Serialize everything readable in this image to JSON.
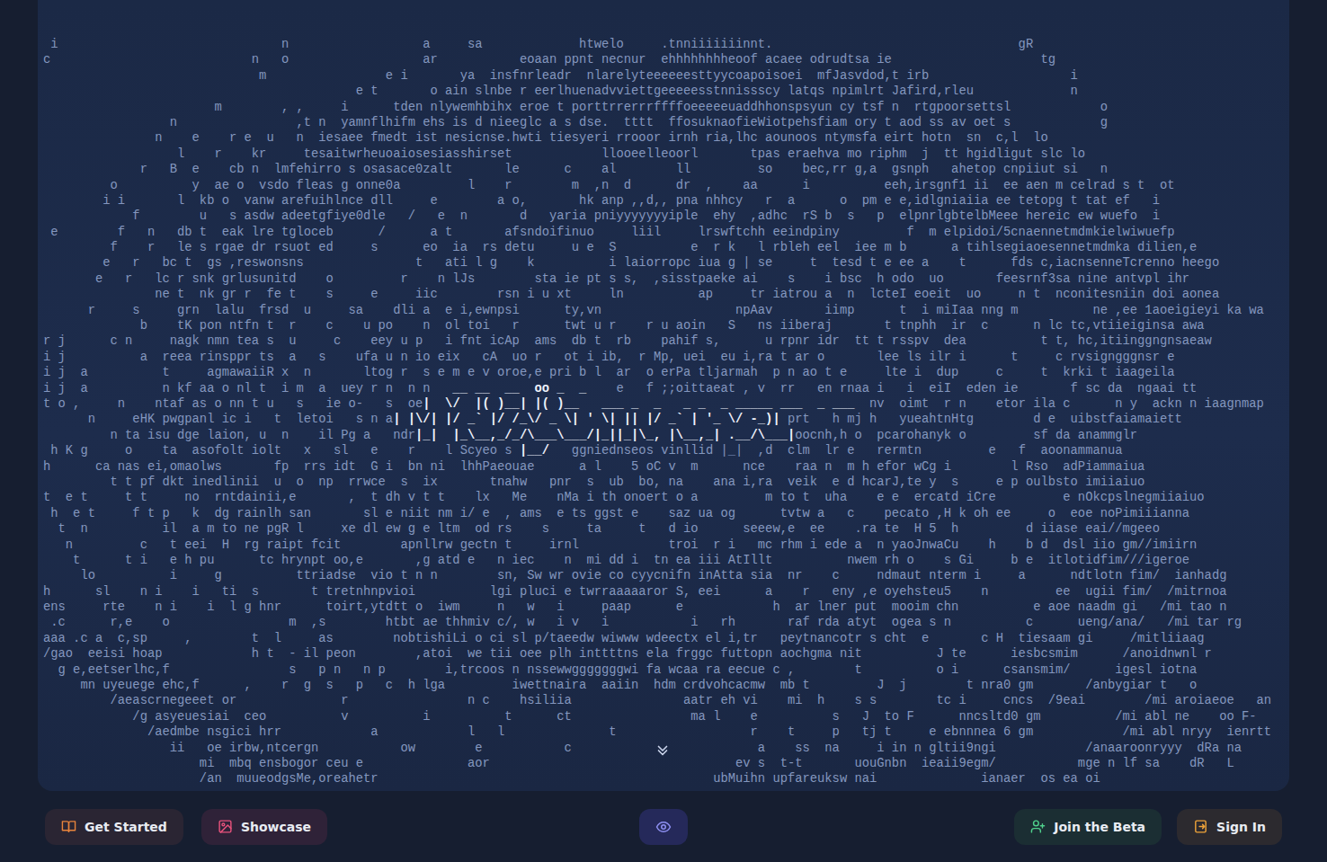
{
  "art": {
    "lines": [
      " i                              n                  a     sa             htwelo     .tnniiiiiiinnt.                                 gR",
      "c                           n   o                  ar           eoaan ppnt necnur  ehhhhhhhheoof acaee odrudtsa ie                    tg",
      "                             m                e i       ya  insfnrleadr  nlarelyteeeeeesttyycoapoisoei  mfJasvdod,t irb                   i",
      "                                          e t       o ain slnbe r eerlhuenadvviettgeeeeesstnnissscy latqs npimlrt Jafird,rleu             n",
      "                       m        , ,     i      tden nlywemhbihx eroe t porttrrerrrffffoeeeeeuaddhhonspsyun cy tsf n  rtgpoorsettsl            o",
      "                 n                ,t n  yamnflhifm ehs is d nieeglc a s dse.  tttt  ffosuknaofieWiotpehsfiam ory t aod ss av oet s            g",
      "               n    e    r e  u   n  iesaee fmedt ist nesicnse.hwti tiesyeri rrooor irnh ria,lhc aounoos ntymsfa eirt hotn  sn  c,l  lo",
      "                  l    r    kr     tesaitwrheuoaiosesiasshirset            llooeelleoorl       tpas eraehva mo riphm  j  tt hgidligut slc lo",
      "             r   B  e    cb n  lmfehirro s osasace0zalt       le      c    al        ll         so    bec,rr g,a  gsnph   ahetop cnpiiut si   n",
      "         o          y  ae o  vsdo fleas g onne0a         l    r        m  ,n  d      dr  ,    aa      i          eeh,irsgnf1 ii  ee aen m celrad s t  ot",
      "        i i       l  kb o  vanw arefuihlnce dll     e        a o,       hk anp ,,d,, pna nhhcy   r  a      o  pm e e,idlgniaiia ee tetopg t tat ef   i",
      "            f        u   s asdw adeetgfiye0dle   /   e  n       d   yaria pniyyyyyyyiple  ehy  ,adhc  rS b  s   p  elpnrlgbtelbMeee hereic ew wuefo  i",
      " e        f   n   db t  eak lre tgloceb      /      a t       afsndoifinuo     liil     lrswftchh eeindpiny         f  m elpidoi/5cnaennetmdmkielwiwuefp",
      "         f    r   le s rgae dr rsuot ed     s      eo  ia  rs detu     u e  S          e  r k   l rbleh eel  iee m b      a tihlsegiaoesennetmdmka dilien,e",
      "        e   r   bc t  gs ,reswonsns               t   ati l g    k          i laiorropc iua g | se     t  tesd t e ee a    t      fds c,iacnsenneTcrenno heego",
      "       e   r   lc r snk grlusunitd    o         r    n lJs        sta ie pt s s,  ,sisstpaeke ai    s    i bsc  h odo  uo       feesrnf3sa nine antvpl ihr",
      "               ne t  nk gr r  fe t    s     e     iic        rsn i u xt     ln          ap     tr iatrou a  n  lcteI eoeit  uo     n t  nconitesniin doi aonea",
      "      r     s     grn  lalu  frsd  u     sa    dli a  e i,ewnpsi      ty,vn                  npAav       iimp      t  i miIaa nng m          ne ,ee 1aoeigieyi ka wa",
      "             b    tK pon ntfn t  r    c    u po    n  ol toi   r      twt u r    r u aoin   S   ns iiberaj       t tnphh  ir  c      n lc tc,vtiieiginsa awa",
      "r j      c n     nagk nmn tea s  u     c    eey u p   i fnt icAp  ams  db t  rb    pahif s,      u rpnr idr  tt t rsspv  dea          t t, hc,itiinggngnsaeaw",
      "i j          a  reea rinsppr ts  a   s    ufa u n io eix   cA  uo r   ot i ib,  r Mp, uei  eu i,ra t ar o       lee ls ilr i      t     c rvsigngggnsr e",
      "i j  a          t     agmawaiiR x  n       ltog r  s e m e v oroe,e pri b l  ar  o erPa tljarmah  p n ao t e     lte i  dup     c     t  krki t iaageila",
      "h      ca nas ei,omaolws       fp  rrs idt  G i  bn ni  lhhPaeouae      a l    5 oC v  m      nce    raa n  m h efor wCg i        l Rso  adPiammaiua",
      "         t t pf dkt inedlinii  u  o  np  rrwce  s  ix       tnahw   pnr  s  ub  bo, na    ana i,ra  veik  e d hcarJ,te y  s     e p oulbsto imiiaiuo",
      "t  e t     t t     no  rntdainii,e       ,  t dh v t t    lx   Me    nMa i th onoert o a         m to t  uha    e e  ercatd iCre         e nOkcpslnegmiiaiuo",
      " h  e t     f t p   k  dg rainlh san       sl e niit nm i/ e  , ams  e ts ggst e    saz ua og      tvtw a   c    pecato ,H k oh ee     o  eoe noPimiiianna",
      "  t  n          il  a m to ne pgR l     xe dl ew g e ltm  od rs    s     ta     t   d io      seeew,e  ee    .ra te  H 5  h         d iiase eai//mgeeo",
      "   n         c   t eei  H  rg raipt fcit        apnllrw gectn t     irnl            troi  r i   mc rhm i ede a  n yaoJnwaCu    h    b d  dsl iio gm//imiirn",
      "    t      t i   e h pu      tc hrynpt oo,e       ,g atd e   n iec    n  mi dd i  tn ea iii AtIllt          nwem rh o    s Gi     b e  itlotidfim///igeroe",
      "     lo          i     g          ttriadse  vio t n n        sn, Sw wr ovie co cyycnifn inAtta sia  nr    c     ndmaut nterm i     a      ndtlotn fim/  ianhadg",
      "h      sl    n i    i   ti  s       t tretnhnpvioi          lgi pluci e twrraaaaaror S, eei      a    r   eny ,e oyehsteu5    n         ee  ugii fim/  /mitrnoa",
      "ens     rte    n i    i  l g hnr      toirt,ytdtt o  iwm     n   w   i     paap      e            h  ar lner put  mooim chn          e aoe naadm gi   /mi tao n",
      " .c      r,e    o                m  ,s        htbt ae thhmiv c/, w   i v   i           i   rh       raf rda atyt  ogea s n          c      ueng/ana/   /mi tar rg",
      "aaa .c a  c,sp     ,        t  l     as        nobtishiLi o ci sl p/taeedw wiwww wdeectx el i,tr   peytnancotr s cht  e       c H  tiesaam gi     /mitliiaag",
      "/gao  eeisi hoap            h t  - il peon        ,atoi  we tii oee plh inttttns ela frggc futtopn aochgma nit          J te      iesbcsmim      /anoidnwnl r",
      "  g e,eetserlhc,f                s   p n   n p        i,trcoos n nssewwgggggggwi fa wcaa ra eecue c ,        t          o i      csansmim/      igesl iotna",
      "     mn uyeuege ehc,f      ,    r  g  s   p   c  h lga         iwettnaira  aaiin  hdm crdvohcacmw  mb t         J  j        t nra0 gm       /anbygiar t   o",
      "         /aeascrnegeeet or              r                n c    hsiliia               aatr eh vi    mi  h    s s        tc i     cncs  /9eai        /mi aroiaeoe   an",
      "            /g asyeuesiai  ceo          v          i          t      ct                ma l    e          s   J  to F      nncsltd0 gm          /mi abl ne    oo F-",
      "              /aedmbe nsgici hrr            a            l   l              t                  r    t     p   tj t     e ebnnnea 6 gm            /mi abl nryy  ienrtt",
      "                 ii   oe irbw,ntcergn           ow        e           c                         a    ss  na     i in n gltii9ngi            /anaaroonryyy  dRa na",
      "                     mi  mbq ensbogor ceu e              aor                                 ev s  t-t       uouGnbn  ieaii9egm/           mge n lf sa    dR   L",
      "                     /an  muueodgsMe,oreahetr                                             ubMuihn upfareuksw nai              ianaer  os ea oi"
    ],
    "logo_after": 22,
    "logo_rows": [
      {
        "left": "i j  a          n kf aa o nl t  i m  a  uey r n  n n  ",
        "logo": " __ __  __  oo _  _ ",
        "right": "   e   f ;;oittaeat , v  rr   en rnaa i   i  eiI  eden ie       f sc da  ngaai tt"
      },
      {
        "left": "t o ,     n    ntaf as o nn t u   s   ie o-   s  oe",
        "logo": "|  \\/  |( )__| |( )__   ___ _  _   _ _  _ _____ ___  _ ___ ",
        "right": " nv  oimt  r n    etor ila c      n y  ackn n iaagnmap"
      },
      {
        "left": "      n     eHK pwgpanl ic i   t  letoi   s n a",
        "logo": "| |\\/| |/ _` |/ /_\\/ _ \\| ' \\| || |/ _` | '_ \\/ -_)| ",
        "right": "prt   h mj h   yueahtnHtg        d e  uibstfaiamaiett"
      },
      {
        "left": "         n ta isu dge laion, u  n    il Pg a   ndr",
        "logo": "|_|  |_\\__,_/_/\\___\\___/|_||_|\\_, |\\__,_| .__/\\___|",
        "right": "oocnh,h o  pcarohanyk o         sf da anammglr"
      },
      {
        "left": " h K g     o    ta  asofolt iolt   x   sl   e    r    l Scyeo s ",
        "logo": "|__/   ",
        "right": "ggniednseos vinllid |_|  ,d  clm  lr e   rermtn         e   f  aoonammanua"
      }
    ]
  },
  "toolbar": {
    "left": [
      {
        "label": "Get Started",
        "icon": "book",
        "color": "#e8843c"
      },
      {
        "label": "Showcase",
        "icon": "image",
        "color": "#e8527c"
      }
    ],
    "right": [
      {
        "label": "Join the Beta",
        "icon": "user-plus",
        "color": "#4fd08c"
      },
      {
        "label": "Sign In",
        "icon": "login",
        "color": "#f0a43a"
      }
    ]
  }
}
